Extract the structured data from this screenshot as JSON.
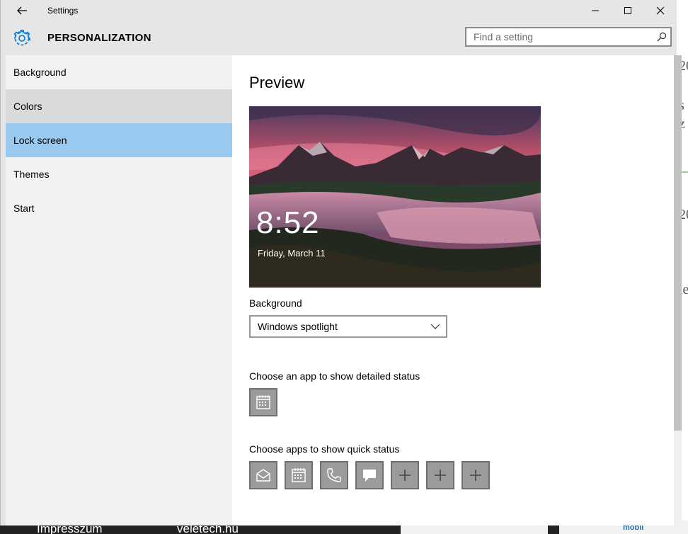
{
  "window": {
    "app_title": "Settings",
    "page_title": "PERSONALIZATION",
    "search_placeholder": "Find a setting"
  },
  "sidebar": {
    "items": [
      {
        "label": "Background",
        "state": "normal"
      },
      {
        "label": "Colors",
        "state": "hover"
      },
      {
        "label": "Lock screen",
        "state": "selected"
      },
      {
        "label": "Themes",
        "state": "normal"
      },
      {
        "label": "Start",
        "state": "normal"
      }
    ]
  },
  "content": {
    "preview_title": "Preview",
    "preview_time": "8:52",
    "preview_date": "Friday, March 11",
    "background_label": "Background",
    "background_value": "Windows spotlight",
    "detailed_status_label": "Choose an app to show detailed status",
    "detailed_status_apps": [
      "calendar-icon"
    ],
    "quick_status_label": "Choose apps to show quick status",
    "quick_status_apps": [
      "mail-icon",
      "calendar-icon",
      "phone-icon",
      "message-icon",
      "add-icon",
      "add-icon",
      "add-icon"
    ]
  },
  "colors": {
    "accent": "#0078d7",
    "selected": "#99c9ef",
    "hover": "#dadada",
    "sidebar_bg": "#f2f2f2",
    "titlebar_bg": "#e6e6e6"
  },
  "background_page": {
    "bottom_left_text": "Impresszum",
    "bottom_mid_text": "veletech.hu",
    "bottom_right_text": "mobil"
  }
}
